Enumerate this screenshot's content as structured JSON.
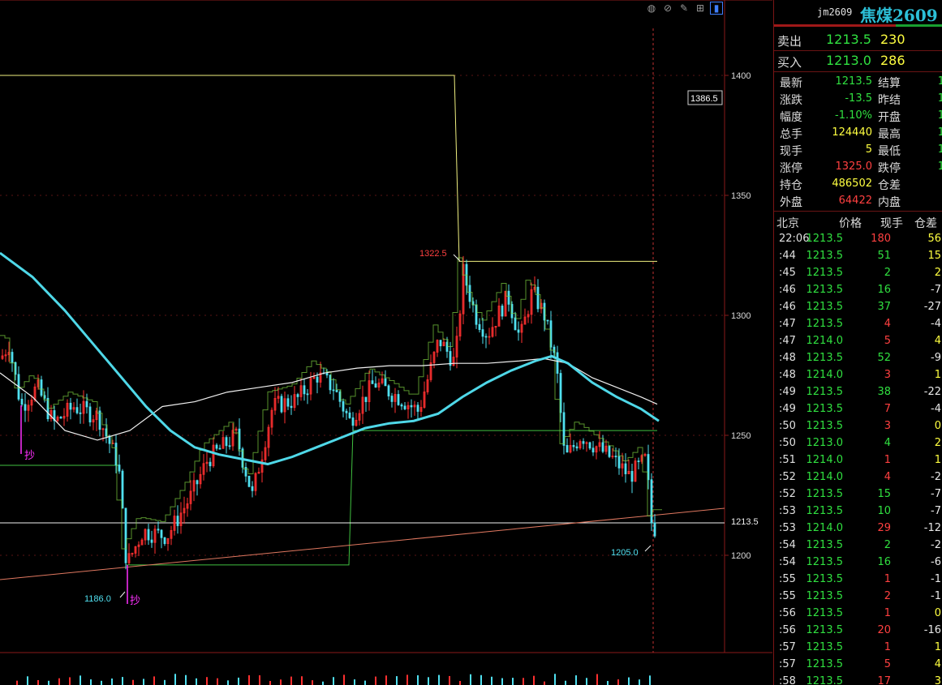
{
  "toolbar": {
    "icons": [
      "lightbulb-icon",
      "eye-off-icon",
      "pencil-icon",
      "grid-icon",
      "panel-icon"
    ]
  },
  "chart": {
    "price_axis_ticks": [
      "1400",
      "1350",
      "1300",
      "1250",
      "1200"
    ],
    "last_price_label": "1213.5",
    "crosshair_price_label": "1386.5",
    "annotations": {
      "high": "1322.5",
      "low": "1186.0",
      "recent_low": "1205.0",
      "signal_mark": "抄"
    },
    "colors": {
      "up": "#ff3030",
      "down": "#50e0f0",
      "ma_short": "#4fd8e8",
      "ma_long": "#f0f0f0",
      "trend_line": "#e07860",
      "box_yellow": "#f0f080",
      "box_green": "#40c040"
    }
  },
  "chart_data": {
    "type": "candlestick",
    "y_ticks": [
      1400,
      1350,
      1300,
      1250,
      1200
    ],
    "ylim": [
      1170,
      1430
    ],
    "last_price": 1213.5,
    "crosshair_price": 1386.5,
    "high": 1322.5,
    "low": 1186.0,
    "recent_low": 1205.0,
    "marker": "抄"
  },
  "quote": {
    "code": "jm2609",
    "name": "焦煤2609",
    "ask": {
      "label": "卖出",
      "price": "1213.5",
      "volume": "230"
    },
    "bid": {
      "label": "买入",
      "price": "1213.0",
      "volume": "286"
    },
    "left_stats": [
      {
        "label": "最新",
        "value": "1213.5",
        "color": "#30e040"
      },
      {
        "label": "涨跌",
        "value": "-13.5",
        "color": "#30e040"
      },
      {
        "label": "幅度",
        "value": "-1.10%",
        "color": "#30e040"
      },
      {
        "label": "总手",
        "value": "124440",
        "color": "#ffff40"
      },
      {
        "label": "现手",
        "value": "5",
        "color": "#ffff40"
      },
      {
        "label": "涨停",
        "value": "1325.0",
        "color": "#ff4040"
      },
      {
        "label": "持仓",
        "value": "486502",
        "color": "#ffff40"
      },
      {
        "label": "外盘",
        "value": "64422",
        "color": "#ff4040"
      }
    ],
    "right_stats": [
      {
        "label": "结算",
        "value": "1"
      },
      {
        "label": "昨结",
        "value": "1"
      },
      {
        "label": "开盘",
        "value": "1"
      },
      {
        "label": "最高",
        "value": "1"
      },
      {
        "label": "最低",
        "value": "1"
      },
      {
        "label": "跌停",
        "value": "1"
      },
      {
        "label": "仓差",
        "value": ""
      },
      {
        "label": "内盘",
        "value": ""
      }
    ]
  },
  "ticks": {
    "headers": {
      "time": "北京",
      "price": "价格",
      "volume": "现手",
      "oi_change": "仓差"
    },
    "rows": [
      {
        "time": "22:06",
        "price": "1213.5",
        "volume": "180",
        "oi": "56",
        "vc": "red",
        "oc": "yellow"
      },
      {
        "time": ":44",
        "price": "1213.5",
        "volume": "51",
        "oi": "15",
        "vc": "green",
        "oc": "yellow"
      },
      {
        "time": ":45",
        "price": "1213.5",
        "volume": "2",
        "oi": "2",
        "vc": "green",
        "oc": "yellow"
      },
      {
        "time": ":46",
        "price": "1213.5",
        "volume": "16",
        "oi": "-7",
        "vc": "green",
        "oc": "white"
      },
      {
        "time": ":46",
        "price": "1213.5",
        "volume": "37",
        "oi": "-27",
        "vc": "green",
        "oc": "white"
      },
      {
        "time": ":47",
        "price": "1213.5",
        "volume": "4",
        "oi": "-4",
        "vc": "red",
        "oc": "white"
      },
      {
        "time": ":47",
        "price": "1214.0",
        "volume": "5",
        "oi": "4",
        "vc": "red",
        "oc": "yellow"
      },
      {
        "time": ":48",
        "price": "1213.5",
        "volume": "52",
        "oi": "-9",
        "vc": "green",
        "oc": "white"
      },
      {
        "time": ":48",
        "price": "1214.0",
        "volume": "3",
        "oi": "1",
        "vc": "red",
        "oc": "yellow"
      },
      {
        "time": ":49",
        "price": "1213.5",
        "volume": "38",
        "oi": "-22",
        "vc": "green",
        "oc": "white"
      },
      {
        "time": ":49",
        "price": "1213.5",
        "volume": "7",
        "oi": "-4",
        "vc": "red",
        "oc": "white"
      },
      {
        "time": ":50",
        "price": "1213.5",
        "volume": "3",
        "oi": "0",
        "vc": "red",
        "oc": "yellow"
      },
      {
        "time": ":50",
        "price": "1213.0",
        "volume": "4",
        "oi": "2",
        "vc": "green",
        "oc": "yellow"
      },
      {
        "time": ":51",
        "price": "1214.0",
        "volume": "1",
        "oi": "1",
        "vc": "red",
        "oc": "yellow"
      },
      {
        "time": ":52",
        "price": "1214.0",
        "volume": "4",
        "oi": "-2",
        "vc": "red",
        "oc": "white"
      },
      {
        "time": ":52",
        "price": "1213.5",
        "volume": "15",
        "oi": "-7",
        "vc": "green",
        "oc": "white"
      },
      {
        "time": ":53",
        "price": "1213.5",
        "volume": "10",
        "oi": "-7",
        "vc": "green",
        "oc": "white"
      },
      {
        "time": ":53",
        "price": "1214.0",
        "volume": "29",
        "oi": "-12",
        "vc": "red",
        "oc": "white"
      },
      {
        "time": ":54",
        "price": "1213.5",
        "volume": "2",
        "oi": "-2",
        "vc": "green",
        "oc": "white"
      },
      {
        "time": ":54",
        "price": "1213.5",
        "volume": "16",
        "oi": "-6",
        "vc": "green",
        "oc": "white"
      },
      {
        "time": ":55",
        "price": "1213.5",
        "volume": "1",
        "oi": "-1",
        "vc": "red",
        "oc": "white"
      },
      {
        "time": ":55",
        "price": "1213.5",
        "volume": "2",
        "oi": "-1",
        "vc": "red",
        "oc": "white"
      },
      {
        "time": ":56",
        "price": "1213.5",
        "volume": "1",
        "oi": "0",
        "vc": "red",
        "oc": "yellow"
      },
      {
        "time": ":56",
        "price": "1213.5",
        "volume": "20",
        "oi": "-16",
        "vc": "red",
        "oc": "white"
      },
      {
        "time": ":57",
        "price": "1213.5",
        "volume": "1",
        "oi": "1",
        "vc": "red",
        "oc": "yellow"
      },
      {
        "time": ":57",
        "price": "1213.5",
        "volume": "5",
        "oi": "4",
        "vc": "red",
        "oc": "yellow"
      },
      {
        "time": ":58",
        "price": "1213.5",
        "volume": "17",
        "oi": "3",
        "vc": "red",
        "oc": "yellow"
      }
    ]
  }
}
